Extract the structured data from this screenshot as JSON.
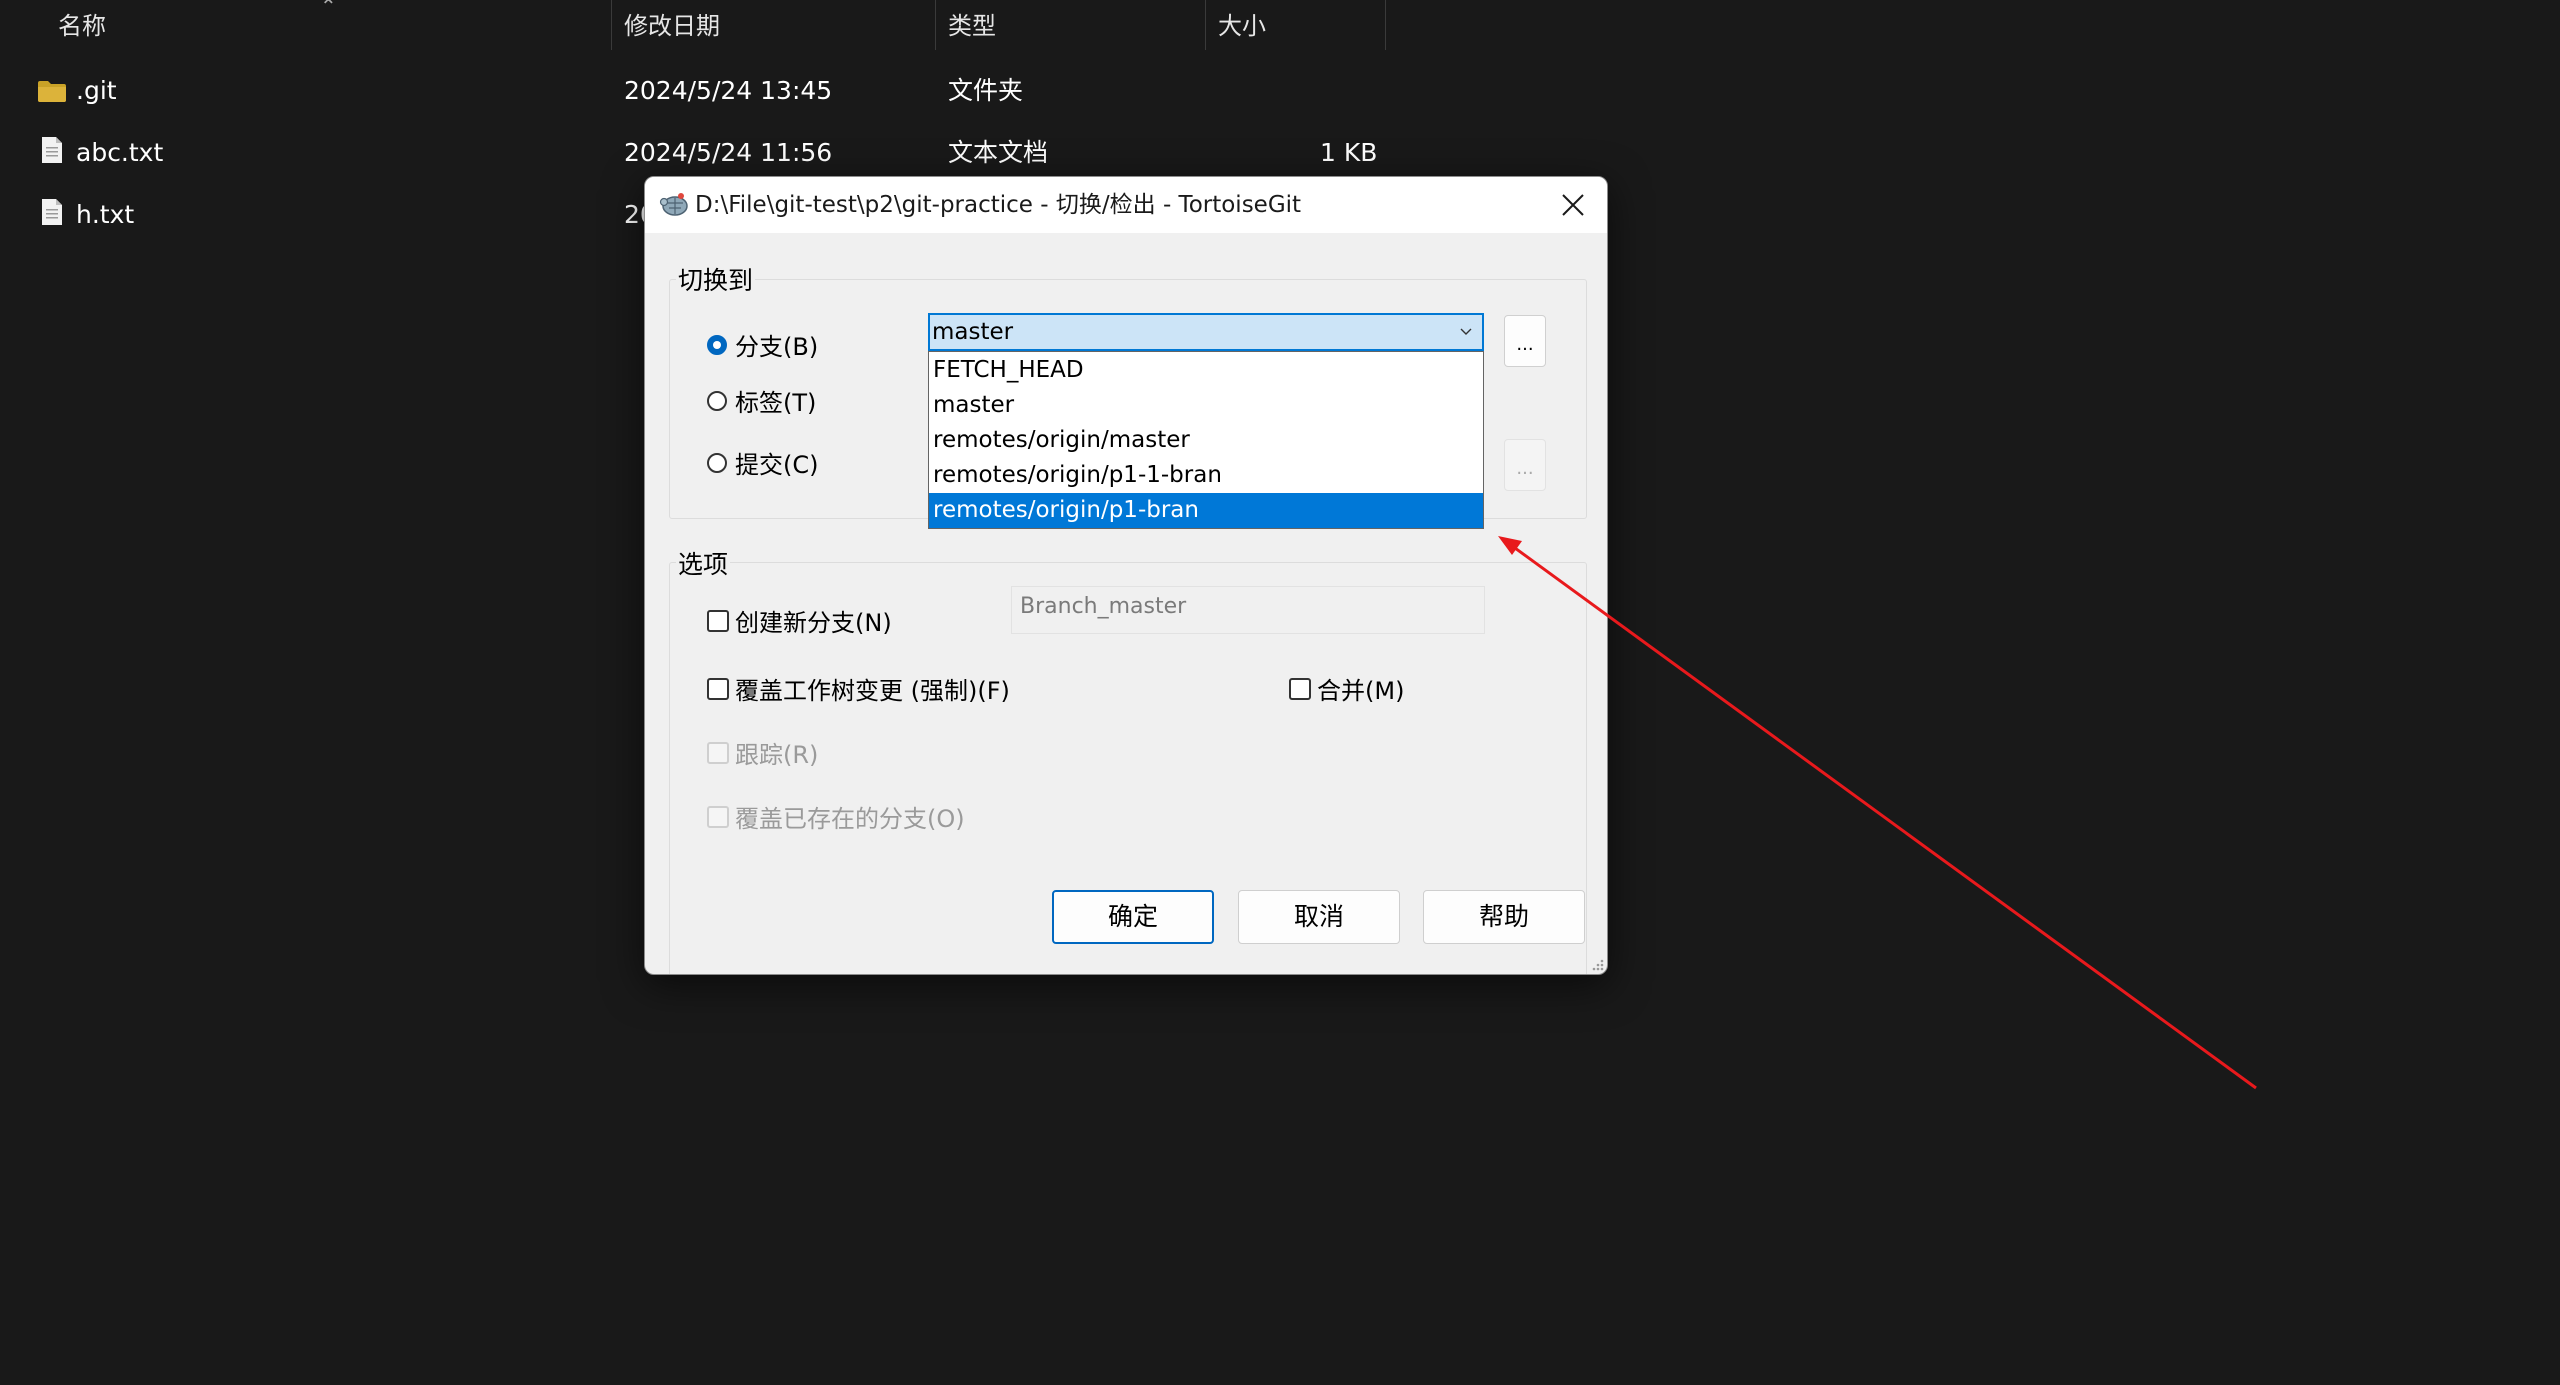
{
  "explorer": {
    "columns": [
      {
        "label": "名称"
      },
      {
        "label": "修改日期"
      },
      {
        "label": "类型"
      },
      {
        "label": "大小"
      }
    ],
    "rows": [
      {
        "name": ".git",
        "modified": "2024/5/24 13:45",
        "type": "文件夹",
        "size": "",
        "icon": "folder-icon"
      },
      {
        "name": "abc.txt",
        "modified": "2024/5/24 11:56",
        "type": "文本文档",
        "size": "1 KB",
        "icon": "text-file-icon"
      },
      {
        "name": "h.txt",
        "modified": "20",
        "type": "",
        "size": "",
        "icon": "text-file-icon"
      }
    ]
  },
  "dialog": {
    "title": "D:\\File\\git-test\\p2\\git-practice - 切换/检出 - TortoiseGit",
    "switch_to": {
      "label": "切换到",
      "branch_label": "分支(B)",
      "tag_label": "标签(T)",
      "commit_label": "提交(C)",
      "selected_radio": "branch",
      "combo_value": "master",
      "dots_label": "...",
      "dropdown_options": [
        {
          "label": "FETCH_HEAD",
          "selected": false
        },
        {
          "label": "master",
          "selected": false
        },
        {
          "label": "remotes/origin/master",
          "selected": false
        },
        {
          "label": "remotes/origin/p1-1-bran",
          "selected": false
        },
        {
          "label": "remotes/origin/p1-bran",
          "selected": true
        }
      ]
    },
    "options": {
      "label": "选项",
      "create_branch": "创建新分支(N)",
      "new_branch_name": "Branch_master",
      "force_overwrite": "覆盖工作树变更 (强制)(F)",
      "merge": "合并(M)",
      "track": "跟踪(R)",
      "override_branch": "覆盖已存在的分支(O)"
    },
    "buttons": {
      "ok": "确定",
      "cancel": "取消",
      "help": "帮助"
    }
  },
  "colors": {
    "accent": "#0078d7",
    "annotation_arrow": "#e8191c",
    "background": "#191919"
  }
}
